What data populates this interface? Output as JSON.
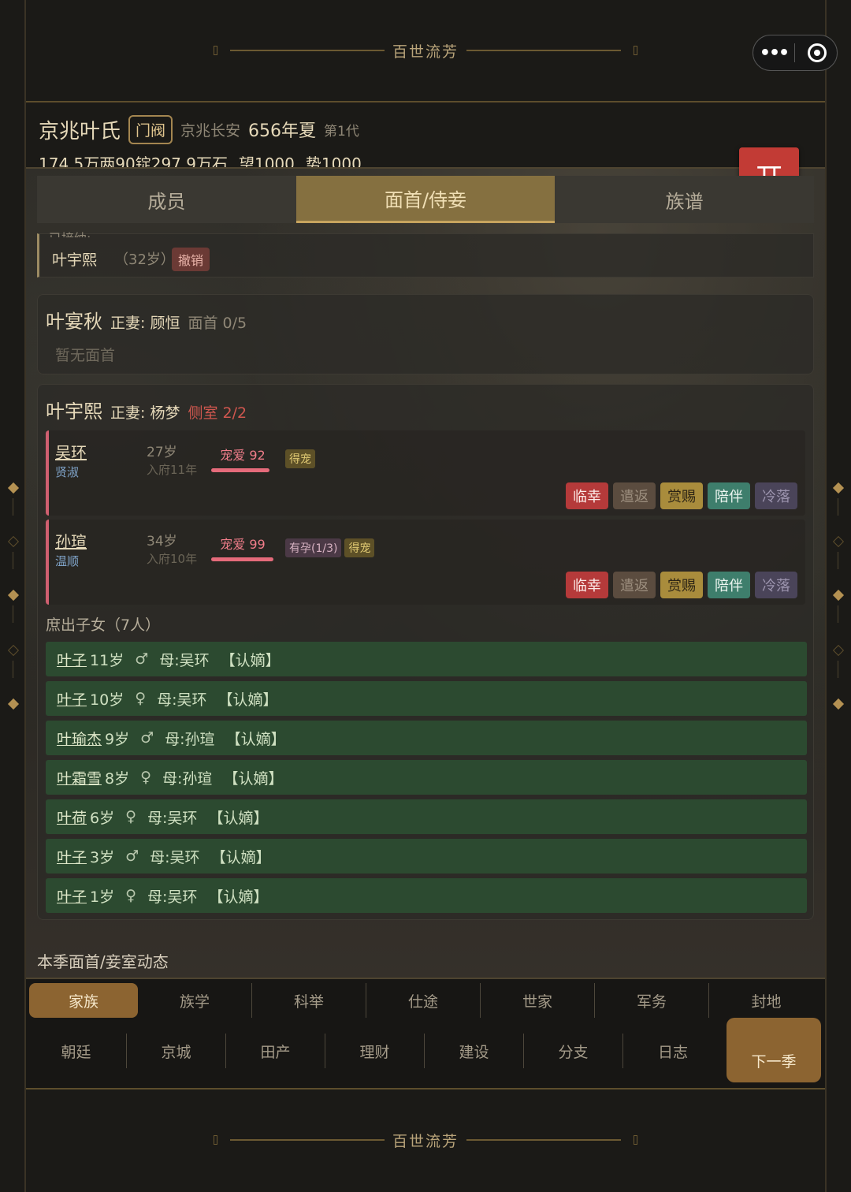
{
  "banner": {
    "title": "百世流芳"
  },
  "capsule": {
    "more_icon": "more-dots-icon",
    "close_icon": "target-icon"
  },
  "header": {
    "clan": "京兆叶氏",
    "rank": "门阀",
    "place": "京兆长安",
    "year": "656年夏",
    "generation": "第1代",
    "silver": "174.5万两",
    "ingot": "90锭",
    "grain": "297.9万石",
    "prestige": "望1000",
    "power": "势1000"
  },
  "kai_button": "开",
  "tabs": [
    {
      "label": "成员",
      "active": false
    },
    {
      "label": "面首/侍妾",
      "active": true
    },
    {
      "label": "族谱",
      "active": false
    }
  ],
  "partial_card": {
    "cut_text": "已接纳:",
    "name": "叶宇熙",
    "age": "（32岁）",
    "revoke": "撤销"
  },
  "card1": {
    "owner": "叶宴秋",
    "spouse": "正妻: 顾恒",
    "quota": "面首 0/5",
    "empty": "暂无面首"
  },
  "card2": {
    "owner": "叶宇熙",
    "spouse": "正妻: 杨梦",
    "quota": "侧室 2/2",
    "consorts": [
      {
        "name": "吴环",
        "trait": "贤淑",
        "age": "27岁",
        "since": "入府11年",
        "favor_label": "宠爱 92",
        "favor_value": 92,
        "tags": [
          {
            "text": "得宠",
            "tone": "yellow"
          }
        ]
      },
      {
        "name": "孙瑄",
        "trait": "温顺",
        "age": "34岁",
        "since": "入府10年",
        "favor_label": "宠爱 99",
        "favor_value": 99,
        "tags": [
          {
            "text": "有孕(1/3)",
            "tone": "purple"
          },
          {
            "text": "得宠",
            "tone": "yellow"
          }
        ]
      }
    ],
    "actions": [
      "临幸",
      "遣返",
      "赏赐",
      "陪伴",
      "冷落"
    ],
    "children_title": "庶出子女（7人）",
    "children": [
      {
        "name": "叶子",
        "age": "11岁",
        "sex": "♂",
        "mother": "母:吴环",
        "status": "【认嫡】"
      },
      {
        "name": "叶子",
        "age": "10岁",
        "sex": "♀",
        "mother": "母:吴环",
        "status": "【认嫡】"
      },
      {
        "name": "叶瑜杰",
        "age": "9岁",
        "sex": "♂",
        "mother": "母:孙瑄",
        "status": "【认嫡】"
      },
      {
        "name": "叶霜雪",
        "age": "8岁",
        "sex": "♀",
        "mother": "母:孙瑄",
        "status": "【认嫡】"
      },
      {
        "name": "叶荷",
        "age": "6岁",
        "sex": "♀",
        "mother": "母:吴环",
        "status": "【认嫡】"
      },
      {
        "name": "叶子",
        "age": "3岁",
        "sex": "♂",
        "mother": "母:吴环",
        "status": "【认嫡】"
      },
      {
        "name": "叶子",
        "age": "1岁",
        "sex": "♀",
        "mother": "母:吴环",
        "status": "【认嫡】"
      }
    ]
  },
  "dynamics_title": "本季面首/妾室动态",
  "nav_row1": [
    {
      "label": "家族",
      "active": true
    },
    {
      "label": "族学",
      "active": false
    },
    {
      "label": "科举",
      "active": false
    },
    {
      "label": "仕途",
      "active": false
    },
    {
      "label": "世家",
      "active": false
    },
    {
      "label": "军务",
      "active": false
    },
    {
      "label": "封地",
      "active": false
    }
  ],
  "nav_row2": [
    "朝廷",
    "京城",
    "田产",
    "理财",
    "建设",
    "分支",
    "日志"
  ],
  "next_button": "下一季",
  "colors": {
    "accent": "#8c6431",
    "kai": "#c23b35",
    "child_row": "#2c4a30",
    "favor": "#e56b7b"
  }
}
